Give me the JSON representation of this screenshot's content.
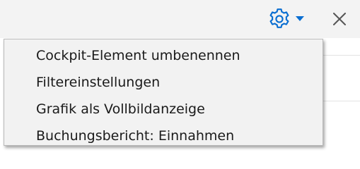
{
  "colors": {
    "accent": "#0a6ed1",
    "menu_background": "#f2f2f2",
    "titlebar_background": "#f3f3f3",
    "text": "#1a1a1a"
  },
  "toolbar": {
    "settings_icon": "gear-icon",
    "dropdown_icon": "caret-down-icon",
    "close_icon": "close-icon"
  },
  "menu": {
    "items": [
      {
        "label": "Cockpit-Element umbenennen"
      },
      {
        "label": "Filtereinstellungen"
      },
      {
        "label": "Grafik als Vollbildanzeige"
      },
      {
        "label": "Buchungsbericht: Einnahmen"
      }
    ]
  }
}
